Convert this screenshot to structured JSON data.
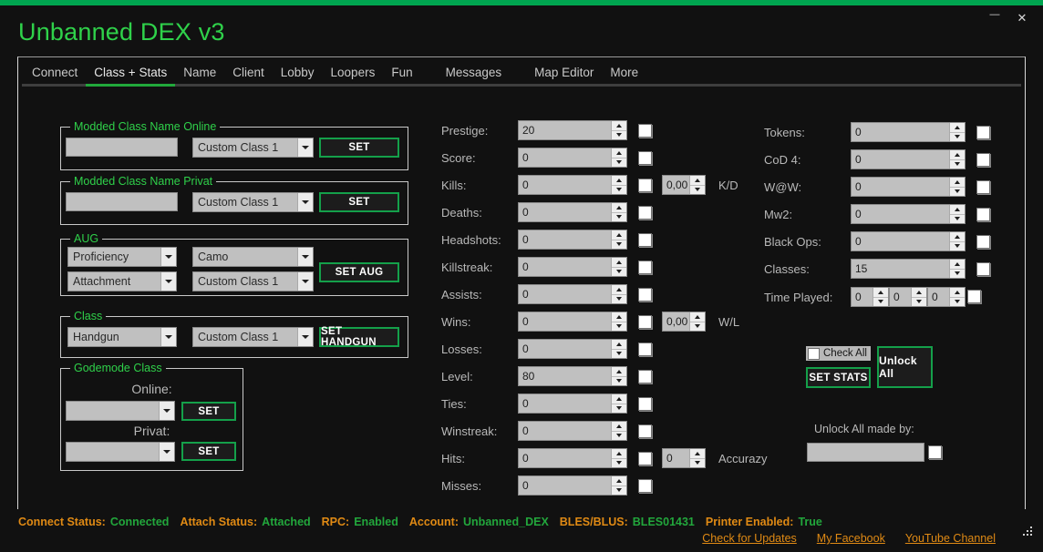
{
  "window": {
    "title": "Unbanned DEX v3",
    "minimize_label": "—",
    "close_label": "✕"
  },
  "tabs": [
    {
      "label": "Connect",
      "active": false
    },
    {
      "label": "Class + Stats",
      "active": true
    },
    {
      "label": "Name",
      "active": false
    },
    {
      "label": "Client",
      "active": false
    },
    {
      "label": "Lobby",
      "active": false
    },
    {
      "label": "Loopers",
      "active": false
    },
    {
      "label": "Fun",
      "active": false
    },
    {
      "label": "Messages",
      "active": false
    },
    {
      "label": "Map Editor",
      "active": false
    },
    {
      "label": "More",
      "active": false
    }
  ],
  "groups": {
    "modded_online": {
      "title": "Modded Class Name Online",
      "name_value": "",
      "class_value": "Custom Class 1",
      "set_label": "SET"
    },
    "modded_privat": {
      "title": "Modded Class Name Privat",
      "name_value": "",
      "class_value": "Custom Class 1",
      "set_label": "SET"
    },
    "aug": {
      "title": "AUG",
      "proficiency_value": "Proficiency",
      "camo_value": "Camo",
      "attachment_value": "Attachment",
      "class_value": "Custom Class 1",
      "set_label": "SET AUG"
    },
    "class": {
      "title": "Class",
      "weapon_value": "Handgun",
      "class_value": "Custom Class 1",
      "set_label": "SET HANDGUN"
    },
    "godemode": {
      "title": "Godemode Class",
      "online_label": "Online:",
      "online_value": "",
      "online_set_label": "SET",
      "privat_label": "Privat:",
      "privat_value": "",
      "privat_set_label": "SET"
    }
  },
  "stats": [
    {
      "label": "Prestige:",
      "value": "20"
    },
    {
      "label": "Score:",
      "value": "0"
    },
    {
      "label": "Kills:",
      "value": "0",
      "extra_value": "0,00",
      "extra_label": "K/D"
    },
    {
      "label": "Deaths:",
      "value": "0"
    },
    {
      "label": "Headshots:",
      "value": "0"
    },
    {
      "label": "Killstreak:",
      "value": "0"
    },
    {
      "label": "Assists:",
      "value": "0"
    },
    {
      "label": "Wins:",
      "value": "0",
      "extra_value": "0,00",
      "extra_label": "W/L"
    },
    {
      "label": "Losses:",
      "value": "0"
    },
    {
      "label": "Level:",
      "value": "80"
    },
    {
      "label": "Ties:",
      "value": "0"
    },
    {
      "label": "Winstreak:",
      "value": "0"
    },
    {
      "label": "Hits:",
      "value": "0",
      "extra_value": "0",
      "extra_label": "Accurazy"
    },
    {
      "label": "Misses:",
      "value": "0"
    }
  ],
  "unlocks": [
    {
      "label": "Tokens:",
      "value": "0"
    },
    {
      "label": "CoD 4:",
      "value": "0"
    },
    {
      "label": "W@W:",
      "value": "0"
    },
    {
      "label": "Mw2:",
      "value": "0"
    },
    {
      "label": "Black Ops:",
      "value": "0"
    },
    {
      "label": "Classes:",
      "value": "15"
    }
  ],
  "time_played": {
    "label": "Time Played:",
    "values": [
      "0",
      "0",
      "0"
    ]
  },
  "actions": {
    "check_all_label": "Check All",
    "set_stats_label": "SET STATS",
    "unlock_all_label": "Unlock All",
    "unlock_made_by_label": "Unlock All made by:",
    "unlock_made_by_value": ""
  },
  "status": {
    "connect_key": "Connect Status:",
    "connect_value": "Connected",
    "attach_key": "Attach Status:",
    "attach_value": "Attached",
    "rpc_key": "RPC:",
    "rpc_value": "Enabled",
    "account_key": "Account:",
    "account_value": "Unbanned_DEX",
    "bles_key": "BLES/BLUS:",
    "bles_value": "BLES01431",
    "printer_key": "Printer Enabled:",
    "printer_value": "True"
  },
  "links": [
    {
      "label": "Check for Updates"
    },
    {
      "label": "My Facebook"
    },
    {
      "label": "YouTube Channel"
    }
  ],
  "colors": {
    "accent_green": "#00a550",
    "title_green": "#2fd14a",
    "status_orange": "#e08a14",
    "status_green": "#22a73c",
    "background": "#111111"
  }
}
